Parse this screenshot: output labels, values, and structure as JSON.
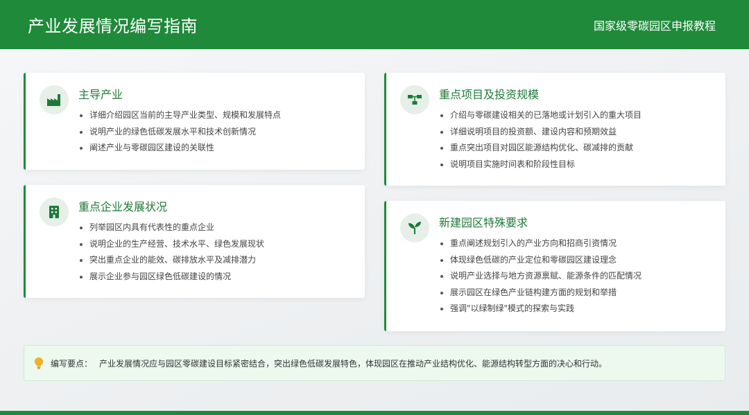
{
  "header": {
    "title": "产业发展情况编写指南",
    "subtitle": "国家级零碳园区申报教程"
  },
  "cards": [
    {
      "icon": "factory-icon",
      "title": "主导产业",
      "items": [
        "详细介绍园区当前的主导产业类型、规模和发展特点",
        "说明产业的绿色低碳发展水平和技术创新情况",
        "阐述产业与零碳园区建设的关联性"
      ]
    },
    {
      "icon": "building-icon",
      "title": "重点企业发展状况",
      "items": [
        "列举园区内具有代表性的重点企业",
        "说明企业的生产经营、技术水平、绿色发展现状",
        "突出重点企业的能效、碳排放水平及减排潜力",
        "展示企业参与园区绿色低碳建设的情况"
      ]
    },
    {
      "icon": "project-diagram-icon",
      "title": "重点项目及投资规模",
      "items": [
        "介绍与零碳建设相关的已落地或计划引入的重大项目",
        "详细说明项目的投资额、建设内容和预期效益",
        "重点突出项目对园区能源结构优化、碳减排的贡献",
        "说明项目实施时间表和阶段性目标"
      ]
    },
    {
      "icon": "seedling-icon",
      "title": "新建园区特殊要求",
      "items": [
        "重点阐述规划引入的产业方向和招商引资情况",
        "体现绿色低碳的产业定位和零碳园区建设理念",
        "说明产业选择与地方资源禀赋、能源条件的匹配情况",
        "展示园区在绿色产业链构建方面的规划和举措",
        "强调\"以绿制绿\"模式的探索与实践"
      ]
    }
  ],
  "tip": {
    "icon": "lightbulb-icon",
    "label": "编写要点：",
    "text": "产业发展情况应与园区零碳建设目标紧密结合，突出绿色低碳发展特色，体现园区在推动产业结构优化、能源结构转型方面的决心和行动。"
  },
  "colors": {
    "brand_green": "#1f8a3a",
    "icon_bg": "#e6efe8",
    "tip_bg": "#edf8ef",
    "bulb": "#f2b01e"
  }
}
